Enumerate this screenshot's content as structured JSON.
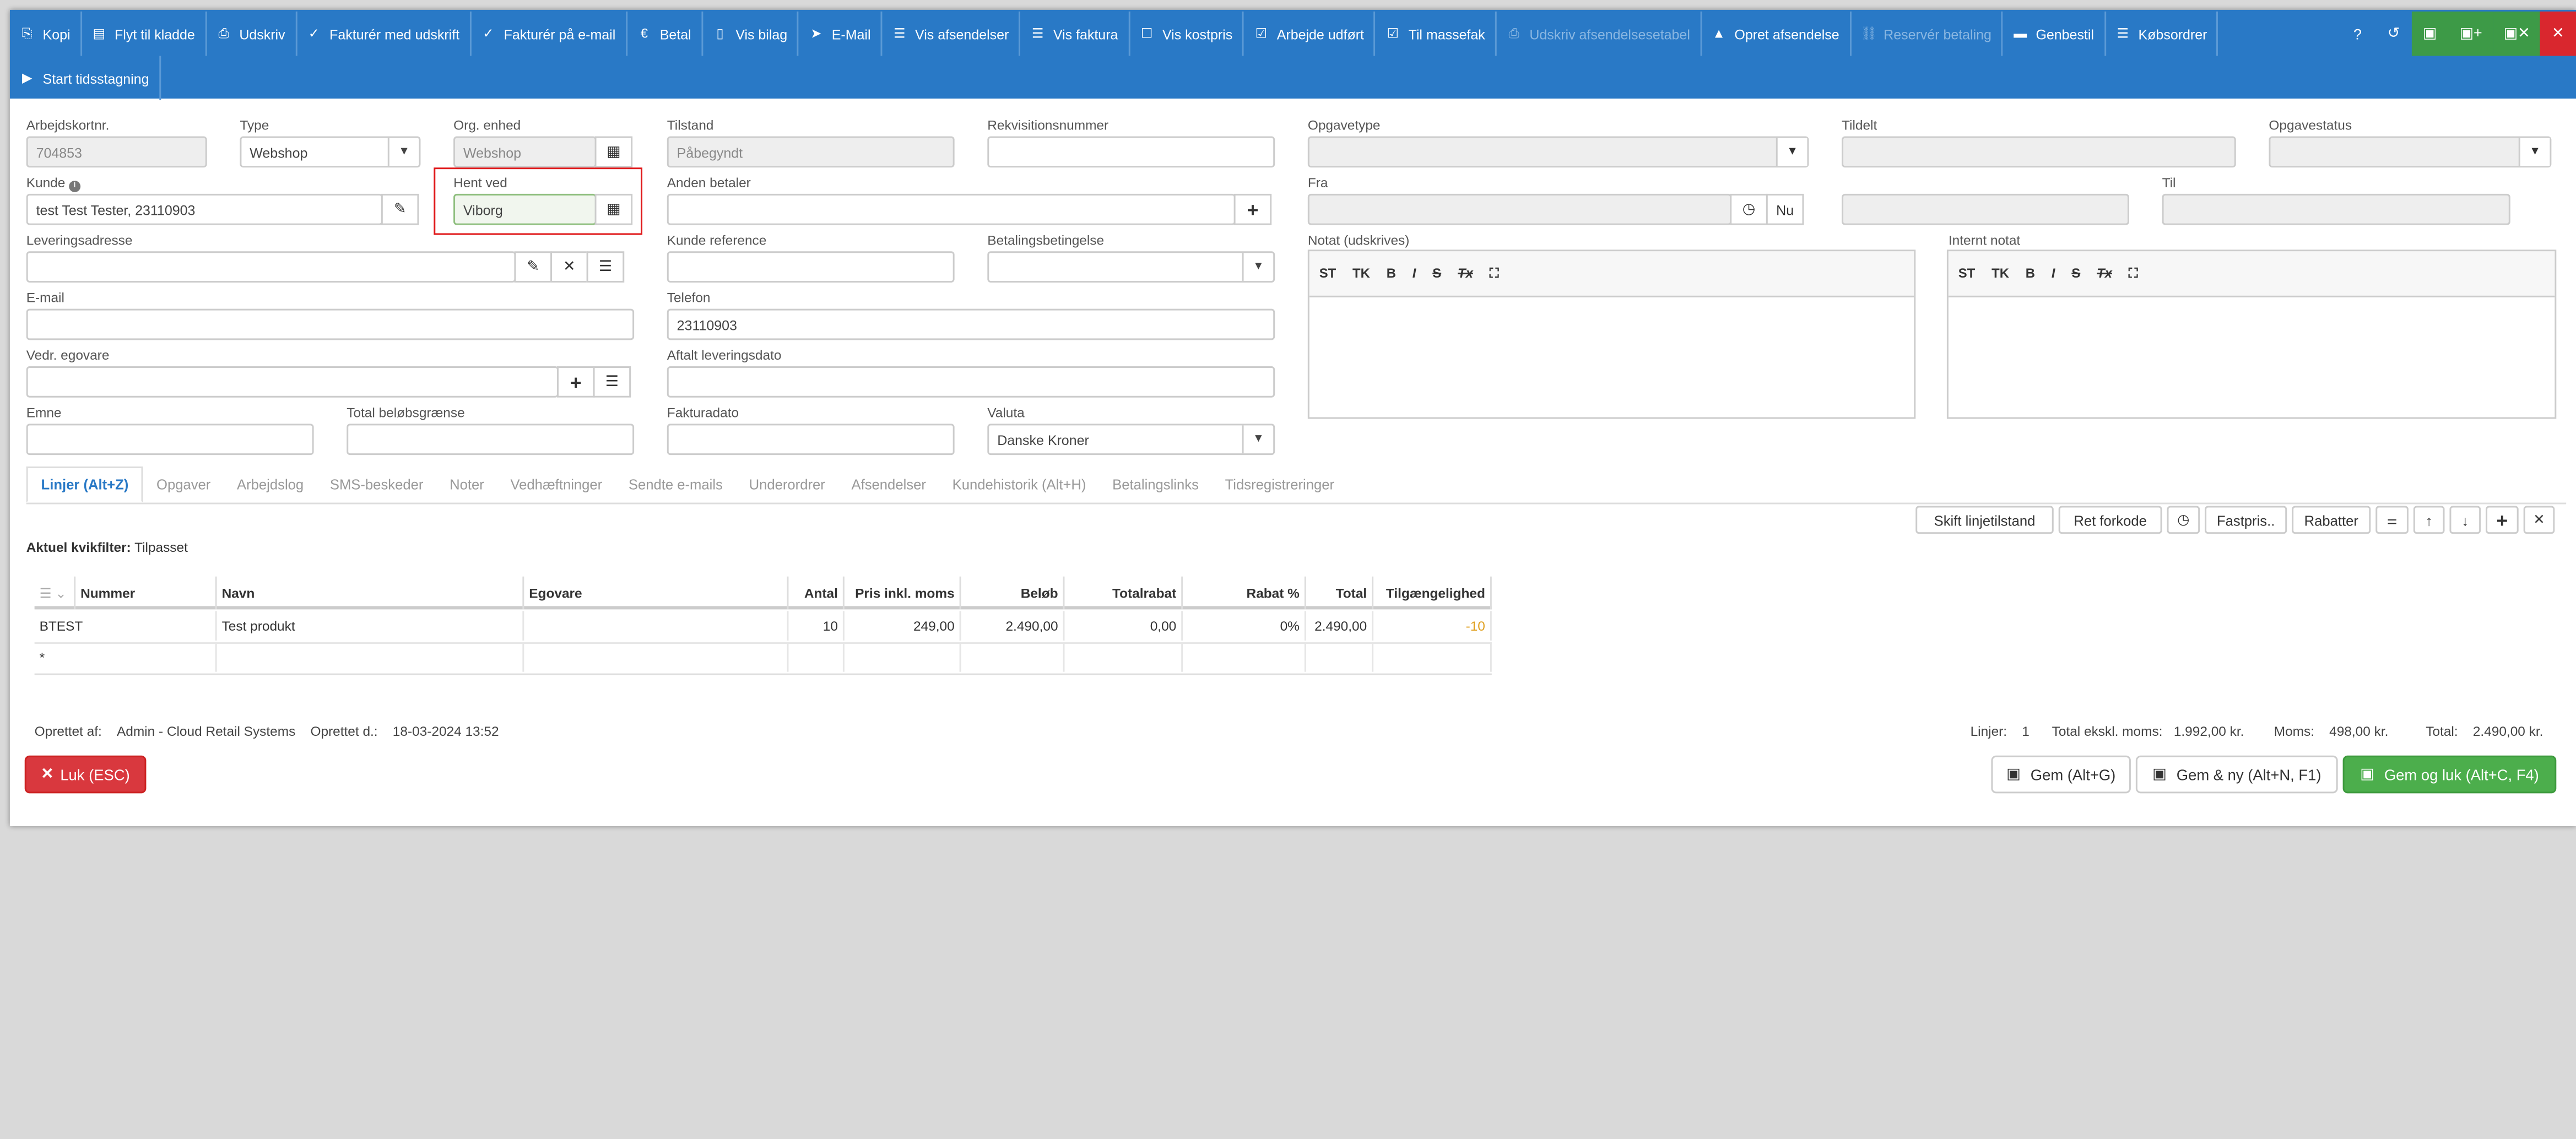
{
  "toolbar": {
    "row1": [
      {
        "icon": "copy-icon",
        "glyph": "⎘",
        "label": "Kopi"
      },
      {
        "icon": "move-icon",
        "glyph": "▤",
        "label": "Flyt til kladde"
      },
      {
        "icon": "print-icon",
        "glyph": "⎙",
        "label": "Udskriv"
      },
      {
        "icon": "check-circle-icon",
        "glyph": "✓",
        "label": "Fakturér med udskrift"
      },
      {
        "icon": "check-circle-icon",
        "glyph": "✓",
        "label": "Fakturér på e-mail"
      },
      {
        "icon": "euro-icon",
        "glyph": "€",
        "label": "Betal"
      },
      {
        "icon": "file-icon",
        "glyph": "▯",
        "label": "Vis bilag"
      },
      {
        "icon": "send-icon",
        "glyph": "➤",
        "label": "E-Mail"
      },
      {
        "icon": "list-icon",
        "glyph": "☰",
        "label": "Vis afsendelser"
      },
      {
        "icon": "list-icon",
        "glyph": "☰",
        "label": "Vis faktura"
      },
      {
        "icon": "checkbox-icon",
        "glyph": "☐",
        "label": "Vis kostpris"
      },
      {
        "icon": "check-square-icon",
        "glyph": "☑",
        "label": "Arbejde udført"
      },
      {
        "icon": "check-square-icon",
        "glyph": "☑",
        "label": "Til massefak"
      },
      {
        "icon": "printer-disabled-icon",
        "glyph": "⎙",
        "label": "Udskriv afsendelsesetabel",
        "disabled": true
      },
      {
        "icon": "road-icon",
        "glyph": "▲",
        "label": "Opret afsendelse"
      },
      {
        "icon": "link-disabled-icon",
        "glyph": "⛓",
        "label": "Reservér betaling",
        "disabled": true
      },
      {
        "icon": "truck-icon",
        "glyph": "▬",
        "label": "Genbestil"
      },
      {
        "icon": "list-icon",
        "glyph": "☰",
        "label": "Købsordrer"
      }
    ],
    "row2": [
      {
        "icon": "play-icon",
        "glyph": "▶",
        "label": "Start tidsstagning"
      }
    ]
  },
  "form": {
    "arbejdskortnr": {
      "label": "Arbejdskortnr.",
      "value": "704853"
    },
    "type": {
      "label": "Type",
      "value": "Webshop"
    },
    "org_enhed": {
      "label": "Org. enhed",
      "value": "Webshop"
    },
    "tilstand": {
      "label": "Tilstand",
      "value": "Påbegyndt"
    },
    "rekvisitionsnummer": {
      "label": "Rekvisitionsnummer",
      "value": ""
    },
    "opgavetype": {
      "label": "Opgavetype",
      "value": ""
    },
    "tildelt": {
      "label": "Tildelt",
      "value": ""
    },
    "opgavestatus": {
      "label": "Opgavestatus",
      "value": ""
    },
    "kunde": {
      "label": "Kunde",
      "value": "test Test Tester, 23110903"
    },
    "hent_ved": {
      "label": "Hent ved",
      "value": "Viborg"
    },
    "anden_betaler": {
      "label": "Anden betaler",
      "value": ""
    },
    "fra": {
      "label": "Fra",
      "value": "",
      "nu": "Nu"
    },
    "til": {
      "label": "Til",
      "value": ""
    },
    "leveringsadresse": {
      "label": "Leveringsadresse",
      "value": ""
    },
    "kunde_reference": {
      "label": "Kunde reference",
      "value": ""
    },
    "betalingsbetingelse": {
      "label": "Betalingsbetingelse",
      "value": ""
    },
    "notat": {
      "label": "Notat (udskrives)"
    },
    "internt_notat": {
      "label": "Internt notat"
    },
    "rte_buttons": [
      "ST",
      "TK",
      "B",
      "I",
      "S",
      "Tx",
      "⛶"
    ],
    "email": {
      "label": "E-mail",
      "value": ""
    },
    "telefon": {
      "label": "Telefon",
      "value": "23110903"
    },
    "vedr_egovare": {
      "label": "Vedr. egovare",
      "value": ""
    },
    "aftalt_leveringsdato": {
      "label": "Aftalt leveringsdato",
      "value": ""
    },
    "emne": {
      "label": "Emne",
      "value": ""
    },
    "total_belobsgraense": {
      "label": "Total beløbsgrænse",
      "value": ""
    },
    "fakturadato": {
      "label": "Fakturadato",
      "value": ""
    },
    "valuta": {
      "label": "Valuta",
      "value": "Danske Kroner"
    }
  },
  "tabs": [
    "Linjer (Alt+Z)",
    "Opgaver",
    "Arbejdslog",
    "SMS-beskeder",
    "Noter",
    "Vedhæftninger",
    "Sendte e-mails",
    "Underordrer",
    "Afsendelser",
    "Kundehistorik (Alt+H)",
    "Betalingslinks",
    "Tidsregistreringer"
  ],
  "line_actions": {
    "skift": "Skift linjetilstand",
    "ret": "Ret forkode",
    "fastpris": "Fastpris..",
    "rabatter": "Rabatter"
  },
  "filter": {
    "label": "Aktuel kvikfilter:",
    "value": "Tilpasset"
  },
  "grid": {
    "columns": [
      "Nummer",
      "Navn",
      "Egovare",
      "Antal",
      "Pris inkl. moms",
      "Beløb",
      "Totalrabat",
      "Rabat %",
      "Total",
      "Tilgængelighed"
    ],
    "rows": [
      [
        "BTEST",
        "Test produkt",
        "",
        "10",
        "249,00",
        "2.490,00",
        "0,00",
        "0%",
        "2.490,00",
        "-10"
      ]
    ],
    "new_row_marker": "*",
    "availability_color": "#e0a020"
  },
  "footer": {
    "oprettet_af_label": "Oprettet af:",
    "oprettet_af": "Admin - Cloud Retail Systems",
    "oprettet_d_label": "Oprettet d.:",
    "oprettet_d": "18-03-2024 13:52",
    "linjer_label": "Linjer:",
    "linjer": "1",
    "total_ekskl_label": "Total ekskl. moms:",
    "total_ekskl": "1.992,00 kr.",
    "moms_label": "Moms:",
    "moms": "498,00 kr.",
    "total_label": "Total:",
    "total": "2.490,00 kr."
  },
  "buttons": {
    "luk": "Luk (ESC)",
    "gem": "Gem (Alt+G)",
    "gem_ny": "Gem & ny (Alt+N, F1)",
    "gem_luk": "Gem og luk (Alt+C, F4)"
  },
  "colors": {
    "toolbar": "#2979c6",
    "green": "#3d9a47",
    "red": "#d9272e",
    "highlight": "#e0191b"
  }
}
